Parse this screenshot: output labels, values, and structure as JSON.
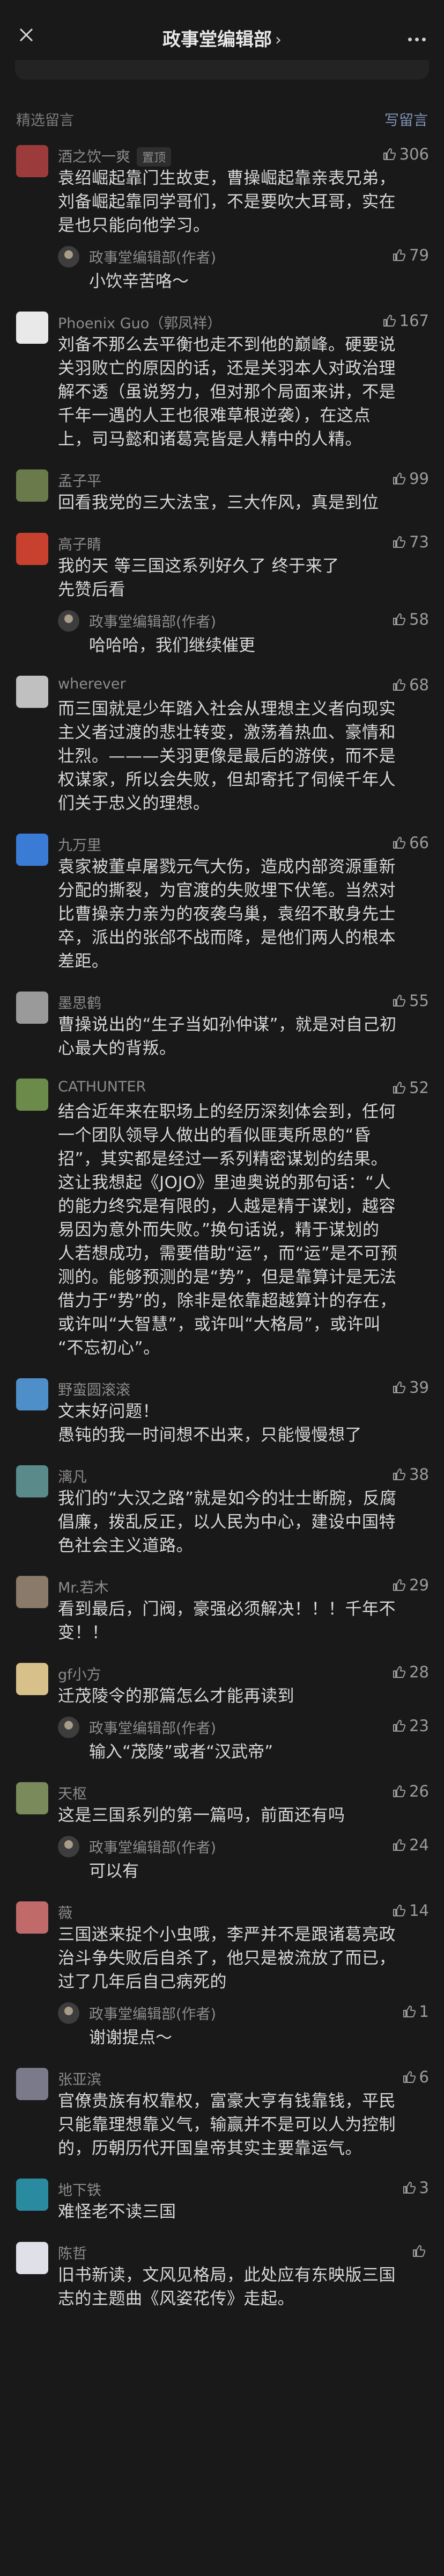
{
  "header": {
    "title": "政事堂编辑部"
  },
  "section": {
    "label": "精选留言",
    "action": "写留言"
  },
  "reply_author": "政事堂编辑部(作者)",
  "comments": [
    {
      "name": "酒之饮一爽",
      "badge": "置顶",
      "likes": "306",
      "lines": [
        "袁绍崛起靠门生故吏，曹操崛起靠亲表兄弟，",
        "刘备崛起靠同学哥们，不是要吹大耳哥，实在",
        "是也只能向他学习。"
      ],
      "reply": {
        "likes": "79",
        "text": "小饮辛苦咯～"
      }
    },
    {
      "name": "Phoenix Guo（郭凤祥）",
      "likes": "167",
      "lines": [
        "刘备不那么去平衡也走不到他的巅峰。硬要说",
        "关羽败亡的原因的话，还是关羽本人对政治理",
        "解不透（虽说努力，但对那个局面来讲，不是",
        "千年一遇的人王也很难草根逆袭），在这点",
        "上，司马懿和诸葛亮皆是人精中的人精。"
      ]
    },
    {
      "name": "孟子平",
      "likes": "99",
      "lines": [
        "回看我党的三大法宝，三大作风，真是到位"
      ]
    },
    {
      "name": "高子睛",
      "likes": "73",
      "lines": [
        "我的天 等三国这系列好久了  终于来了",
        "先赞后看"
      ],
      "reply": {
        "likes": "58",
        "text": "哈哈哈，我们继续催更"
      }
    },
    {
      "name": "wherever",
      "likes": "68",
      "lines": [
        "而三国就是少年踏入社会从理想主义者向现实",
        "主义者过渡的悲壮转变，激荡着热血、豪情和",
        "壮烈。———关羽更像是最后的游侠，而不是",
        "权谋家，所以会失败，但却寄托了伺候千年人",
        "们关于忠义的理想。"
      ]
    },
    {
      "name": "九万里",
      "likes": "66",
      "lines": [
        "袁家被董卓屠戮元气大伤，造成内部资源重新",
        "分配的撕裂，为官渡的失败埋下伏笔。当然对",
        "比曹操亲力亲为的夜袭乌巢，袁绍不敢身先士",
        "卒，派出的张郃不战而降，是他们两人的根本",
        "差距。"
      ]
    },
    {
      "name": "墨思鹤",
      "likes": "55",
      "lines": [
        "曹操说出的“生子当如孙仲谋”，就是对自己初",
        "心最大的背叛。"
      ]
    },
    {
      "name": "CATHUNTER",
      "likes": "52",
      "lines": [
        "结合近年来在职场上的经历深刻体会到，任何",
        "一个团队领导人做出的看似匪夷所思的“昏",
        "招”，其实都是经过一系列精密谋划的结果。",
        "这让我想起《JOJO》里迪奥说的那句话：“人",
        "的能力终究是有限的，人越是精于谋划，越容",
        "易因为意外而失败。”换句话说，精于谋划的",
        "人若想成功，需要借助“运”，而“运”是不可预",
        "测的。能够预测的是“势”，但是靠算计是无法",
        "借力于“势”的，除非是依靠超越算计的存在，",
        "或许叫“大智慧”，或许叫“大格局”，或许叫",
        "“不忘初心”。"
      ]
    },
    {
      "name": "野蛮圆滚滚",
      "likes": "39",
      "lines": [
        "文末好问题！",
        "愚钝的我一时间想不出来，只能慢慢想了"
      ]
    },
    {
      "name": "漓凡",
      "likes": "38",
      "lines": [
        "我们的“大汉之路”就是如今的壮士断腕，反腐",
        "倡廉，拨乱反正，以人民为中心，建设中国特",
        "色社会主义道路。"
      ]
    },
    {
      "name": "Mr.若木",
      "likes": "29",
      "lines": [
        "看到最后，门阀，豪强必须解决！！！千年不",
        "变！！"
      ]
    },
    {
      "name": "gf小方",
      "likes": "28",
      "lines": [
        "迁茂陵令的那篇怎么才能再读到"
      ],
      "reply": {
        "likes": "23",
        "text": "输入“茂陵”或者“汉武帝”"
      }
    },
    {
      "name": "天枢",
      "likes": "26",
      "lines": [
        "这是三国系列的第一篇吗，前面还有吗"
      ],
      "reply": {
        "likes": "24",
        "text": "可以有"
      }
    },
    {
      "name": "薇",
      "likes": "14",
      "lines": [
        "三国迷来捉个小虫哦，李严并不是跟诸葛亮政",
        "治斗争失败后自杀了，他只是被流放了而已，",
        "过了几年后自己病死的"
      ],
      "reply": {
        "likes": "1",
        "text": "谢谢提点～"
      }
    },
    {
      "name": "张亚滨",
      "likes": "6",
      "lines": [
        "官僚贵族有权靠权，富豪大亨有钱靠钱，平民",
        "只能靠理想靠义气，输赢并不是可以人为控制",
        "的，历朝历代开国皇帝其实主要靠运气。"
      ]
    },
    {
      "name": "地下铁",
      "likes": "3",
      "lines": [
        "难怪老不读三国"
      ]
    },
    {
      "name": "陈哲",
      "likes": "",
      "lines": [
        "旧书新读，文风见格局，此处应有东映版三国",
        "志的主题曲《风姿花传》走起。"
      ]
    }
  ],
  "colors": {
    "background": "#191919",
    "accent": "#7f93b6",
    "text": "#d8d8d8",
    "meta": "#8c8c8c"
  }
}
